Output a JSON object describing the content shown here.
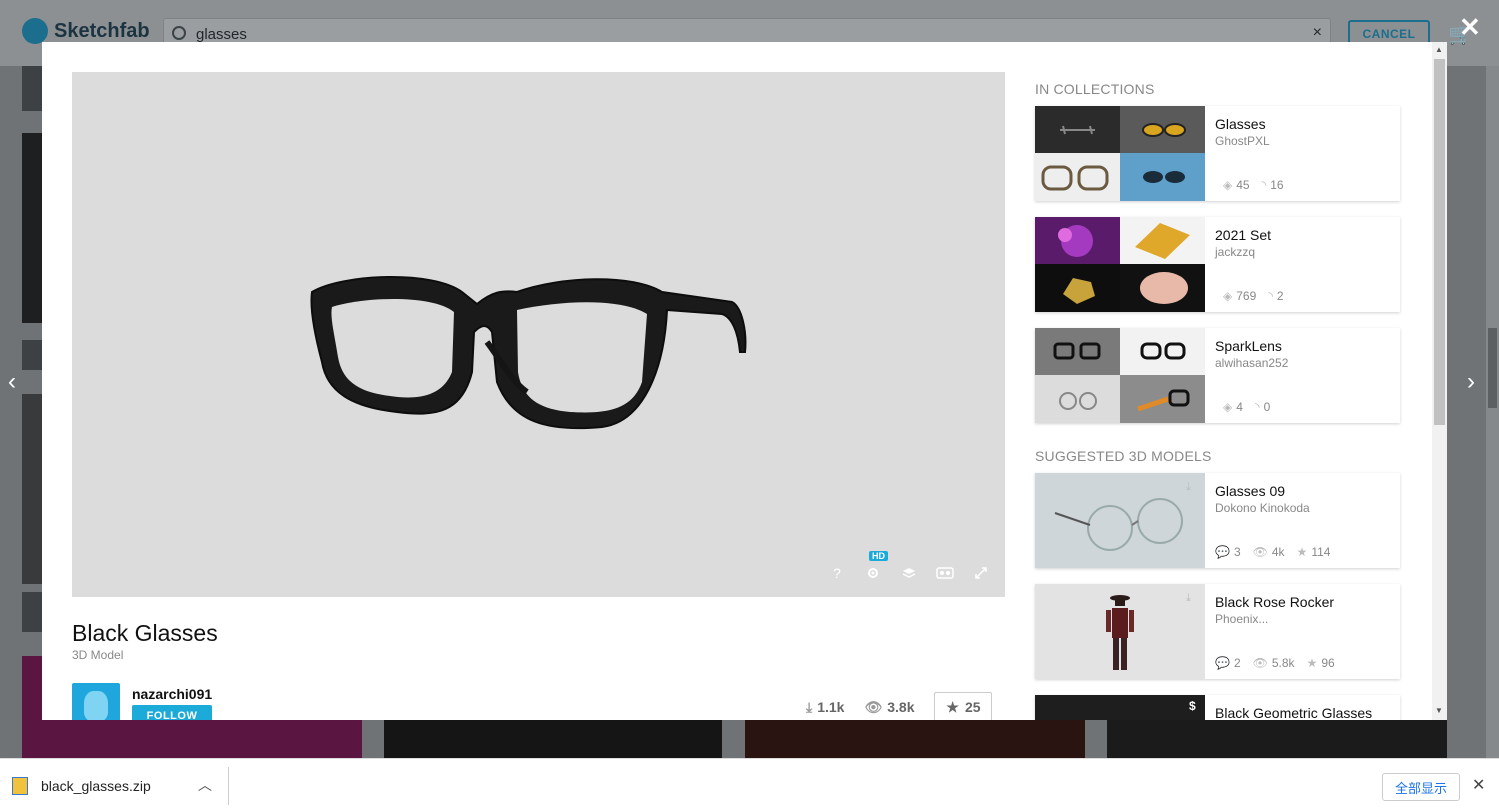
{
  "site": {
    "logo": "Sketchfab",
    "search_value": "glasses",
    "clear_glyph": "×",
    "cancel_label": "CANCEL",
    "cart_glyph": "🛒"
  },
  "overlay": {
    "close_glyph": "✕",
    "prev_glyph": "‹",
    "next_glyph": "›"
  },
  "viewer": {
    "help_glyph": "?",
    "hd_badge": "HD",
    "tools": [
      "help-icon",
      "settings-icon",
      "layers-icon",
      "vr-icon",
      "fullscreen-icon"
    ]
  },
  "model": {
    "title": "Black Glasses",
    "subtitle": "3D Model",
    "author": "nazarchi091",
    "follow_label": "FOLLOW",
    "downloads": "1.1k",
    "views": "3.8k",
    "likes": "25"
  },
  "collections": {
    "heading": "IN COLLECTIONS",
    "items": [
      {
        "title": "Glasses",
        "user": "GhostPXL",
        "models": "45",
        "followers": "16"
      },
      {
        "title": "2021 Set",
        "user": "jackzzq",
        "models": "769",
        "followers": "2"
      },
      {
        "title": "SparkLens",
        "user": "alwihasan252",
        "models": "4",
        "followers": "0"
      }
    ]
  },
  "suggested": {
    "heading": "SUGGESTED 3D MODELS",
    "items": [
      {
        "title": "Glasses 09",
        "user": "Dokono Kinokoda",
        "comments": "3",
        "views": "4k",
        "likes": "114"
      },
      {
        "title": "Black Rose Rocker",
        "user": "Phoenix...",
        "comments": "2",
        "views": "5.8k",
        "likes": "96"
      },
      {
        "title": "Black Geometric Glasses",
        "price_glyph": "$"
      }
    ]
  },
  "download_bar": {
    "filename": "black_glasses.zip",
    "show_all": "全部显示",
    "close_glyph": "✕"
  },
  "colors": {
    "accent": "#1caad9",
    "modal_bg": "#ffffff",
    "viewer_bg": "#dcdcdc"
  }
}
